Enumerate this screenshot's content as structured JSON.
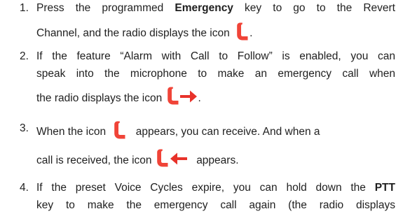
{
  "steps": [
    {
      "number": "1.",
      "l1_pre": "Press the programmed ",
      "l1_bold": "Emergency",
      "l1_post": " key to go to the Revert",
      "l2_pre": "Channel, and the radio displays the icon",
      "l2_post": "."
    },
    {
      "number": "2.",
      "l1": "If the feature “Alarm with Call to Follow” is enabled, you can",
      "l2": "speak into the microphone to make an emergency call when",
      "l3_pre": "the radio displays the icon",
      "l3_post": "."
    },
    {
      "number": "3.",
      "l1_pre": "When the icon",
      "l1_post": "appears, you can receive. And when a",
      "l2_pre": "call is received, the icon",
      "l2_post": "appears."
    },
    {
      "number": "4.",
      "l1_pre": "If the preset Voice Cycles expire, you can hold down the ",
      "l1_bold": "PTT",
      "l2": "key to make the emergency call again (the radio displays"
    }
  ],
  "colors": {
    "phone_icon": "#f04438",
    "arrow": "#e8322a"
  },
  "icons": [
    "emergency-phone-icon",
    "outgoing-call-icon",
    "incoming-call-icon"
  ]
}
